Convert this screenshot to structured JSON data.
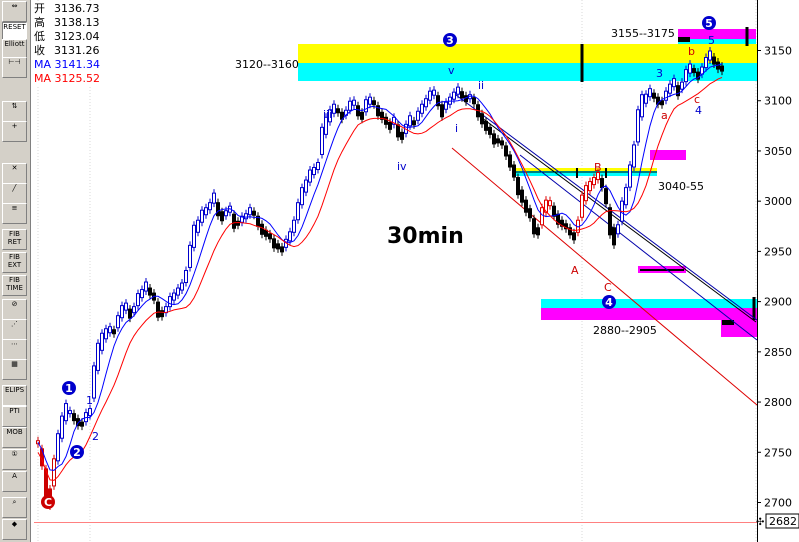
{
  "toolbar": {
    "items": [
      {
        "name": "zoom-fit-icon",
        "label": "⇔"
      },
      {
        "name": "reset-button",
        "label": "RESET"
      },
      {
        "name": "elliott-button",
        "label": "Elliott"
      },
      {
        "name": "wave-ticks-icon",
        "label": "⊢⊣"
      },
      {
        "name": "wave-flags-icon",
        "label": "⇅"
      },
      {
        "name": "crosshair-icon",
        "label": "+"
      },
      {
        "name": "close-x-icon",
        "label": "✕"
      },
      {
        "name": "trendline-icon",
        "label": "╱"
      },
      {
        "name": "channel-icon",
        "label": "≡"
      },
      {
        "name": "fib-ret-button",
        "label": "FIB RET"
      },
      {
        "name": "fib-ext-button",
        "label": "FIB EXT"
      },
      {
        "name": "fib-time-button",
        "label": "FIB TIME"
      },
      {
        "name": "fib-fan-icon",
        "label": "⊘"
      },
      {
        "name": "fan-lines-icon",
        "label": "⋰"
      },
      {
        "name": "speed-lines-icon",
        "label": "⋯"
      },
      {
        "name": "grid-icon",
        "label": "▦"
      },
      {
        "name": "ellipse-button",
        "label": "ELIPS"
      },
      {
        "name": "pattern-icon",
        "label": "⋈"
      },
      {
        "name": "pti-button",
        "label": "PTI"
      },
      {
        "name": "mob-button",
        "label": "MOB"
      },
      {
        "name": "wave-count-icon",
        "label": "①"
      },
      {
        "name": "text-tool-button",
        "label": "A"
      },
      {
        "name": "zoom-icon",
        "label": "⌕"
      },
      {
        "name": "eraser-icon",
        "label": "◆"
      }
    ]
  },
  "ohlc": [
    {
      "key": "开",
      "value": "3136.73"
    },
    {
      "key": "高",
      "value": "3138.13"
    },
    {
      "key": "低",
      "value": "3123.04"
    },
    {
      "key": "收",
      "value": "3131.26"
    }
  ],
  "ma": [
    {
      "label": "MA",
      "value": "3141.34",
      "color": "#0000ff"
    },
    {
      "label": "MA",
      "value": "3125.52",
      "color": "#ff0000"
    }
  ],
  "chart_data": {
    "type": "candlestick",
    "title": "30min",
    "yaxis": {
      "ticks": [
        2700,
        2750,
        2800,
        2850,
        2900,
        2950,
        3000,
        3050,
        3100,
        3150
      ],
      "range": [
        2682,
        3190
      ],
      "current_low_label": "2682"
    },
    "annotations": {
      "zones": [
        {
          "label": "3120--3160",
          "lo": 3120,
          "hi": 3160
        },
        {
          "label": "3155--3175",
          "lo": 3155,
          "hi": 3175
        },
        {
          "label": "3040-55",
          "lo": 3040,
          "hi": 3055
        },
        {
          "label": "2880--2905",
          "lo": 2880,
          "hi": 2905
        }
      ]
    },
    "waves": [
      {
        "text": "C",
        "style": "circle-red"
      },
      {
        "text": "1",
        "style": "circle-blue"
      },
      {
        "text": "2",
        "style": "circle-blue"
      },
      {
        "text": "3",
        "style": "circle-blue"
      },
      {
        "text": "4",
        "style": "circle-blue"
      },
      {
        "text": "5",
        "style": "circle-blue"
      },
      {
        "text": "1"
      },
      {
        "text": "2"
      },
      {
        "text": "i"
      },
      {
        "text": "ii"
      },
      {
        "text": "iii"
      },
      {
        "text": "iv"
      },
      {
        "text": "v"
      },
      {
        "text": "3"
      },
      {
        "text": "4"
      },
      {
        "text": "5"
      },
      {
        "text": "a"
      },
      {
        "text": "b"
      },
      {
        "text": "c"
      },
      {
        "text": "A"
      },
      {
        "text": "B"
      },
      {
        "text": "C"
      }
    ]
  }
}
